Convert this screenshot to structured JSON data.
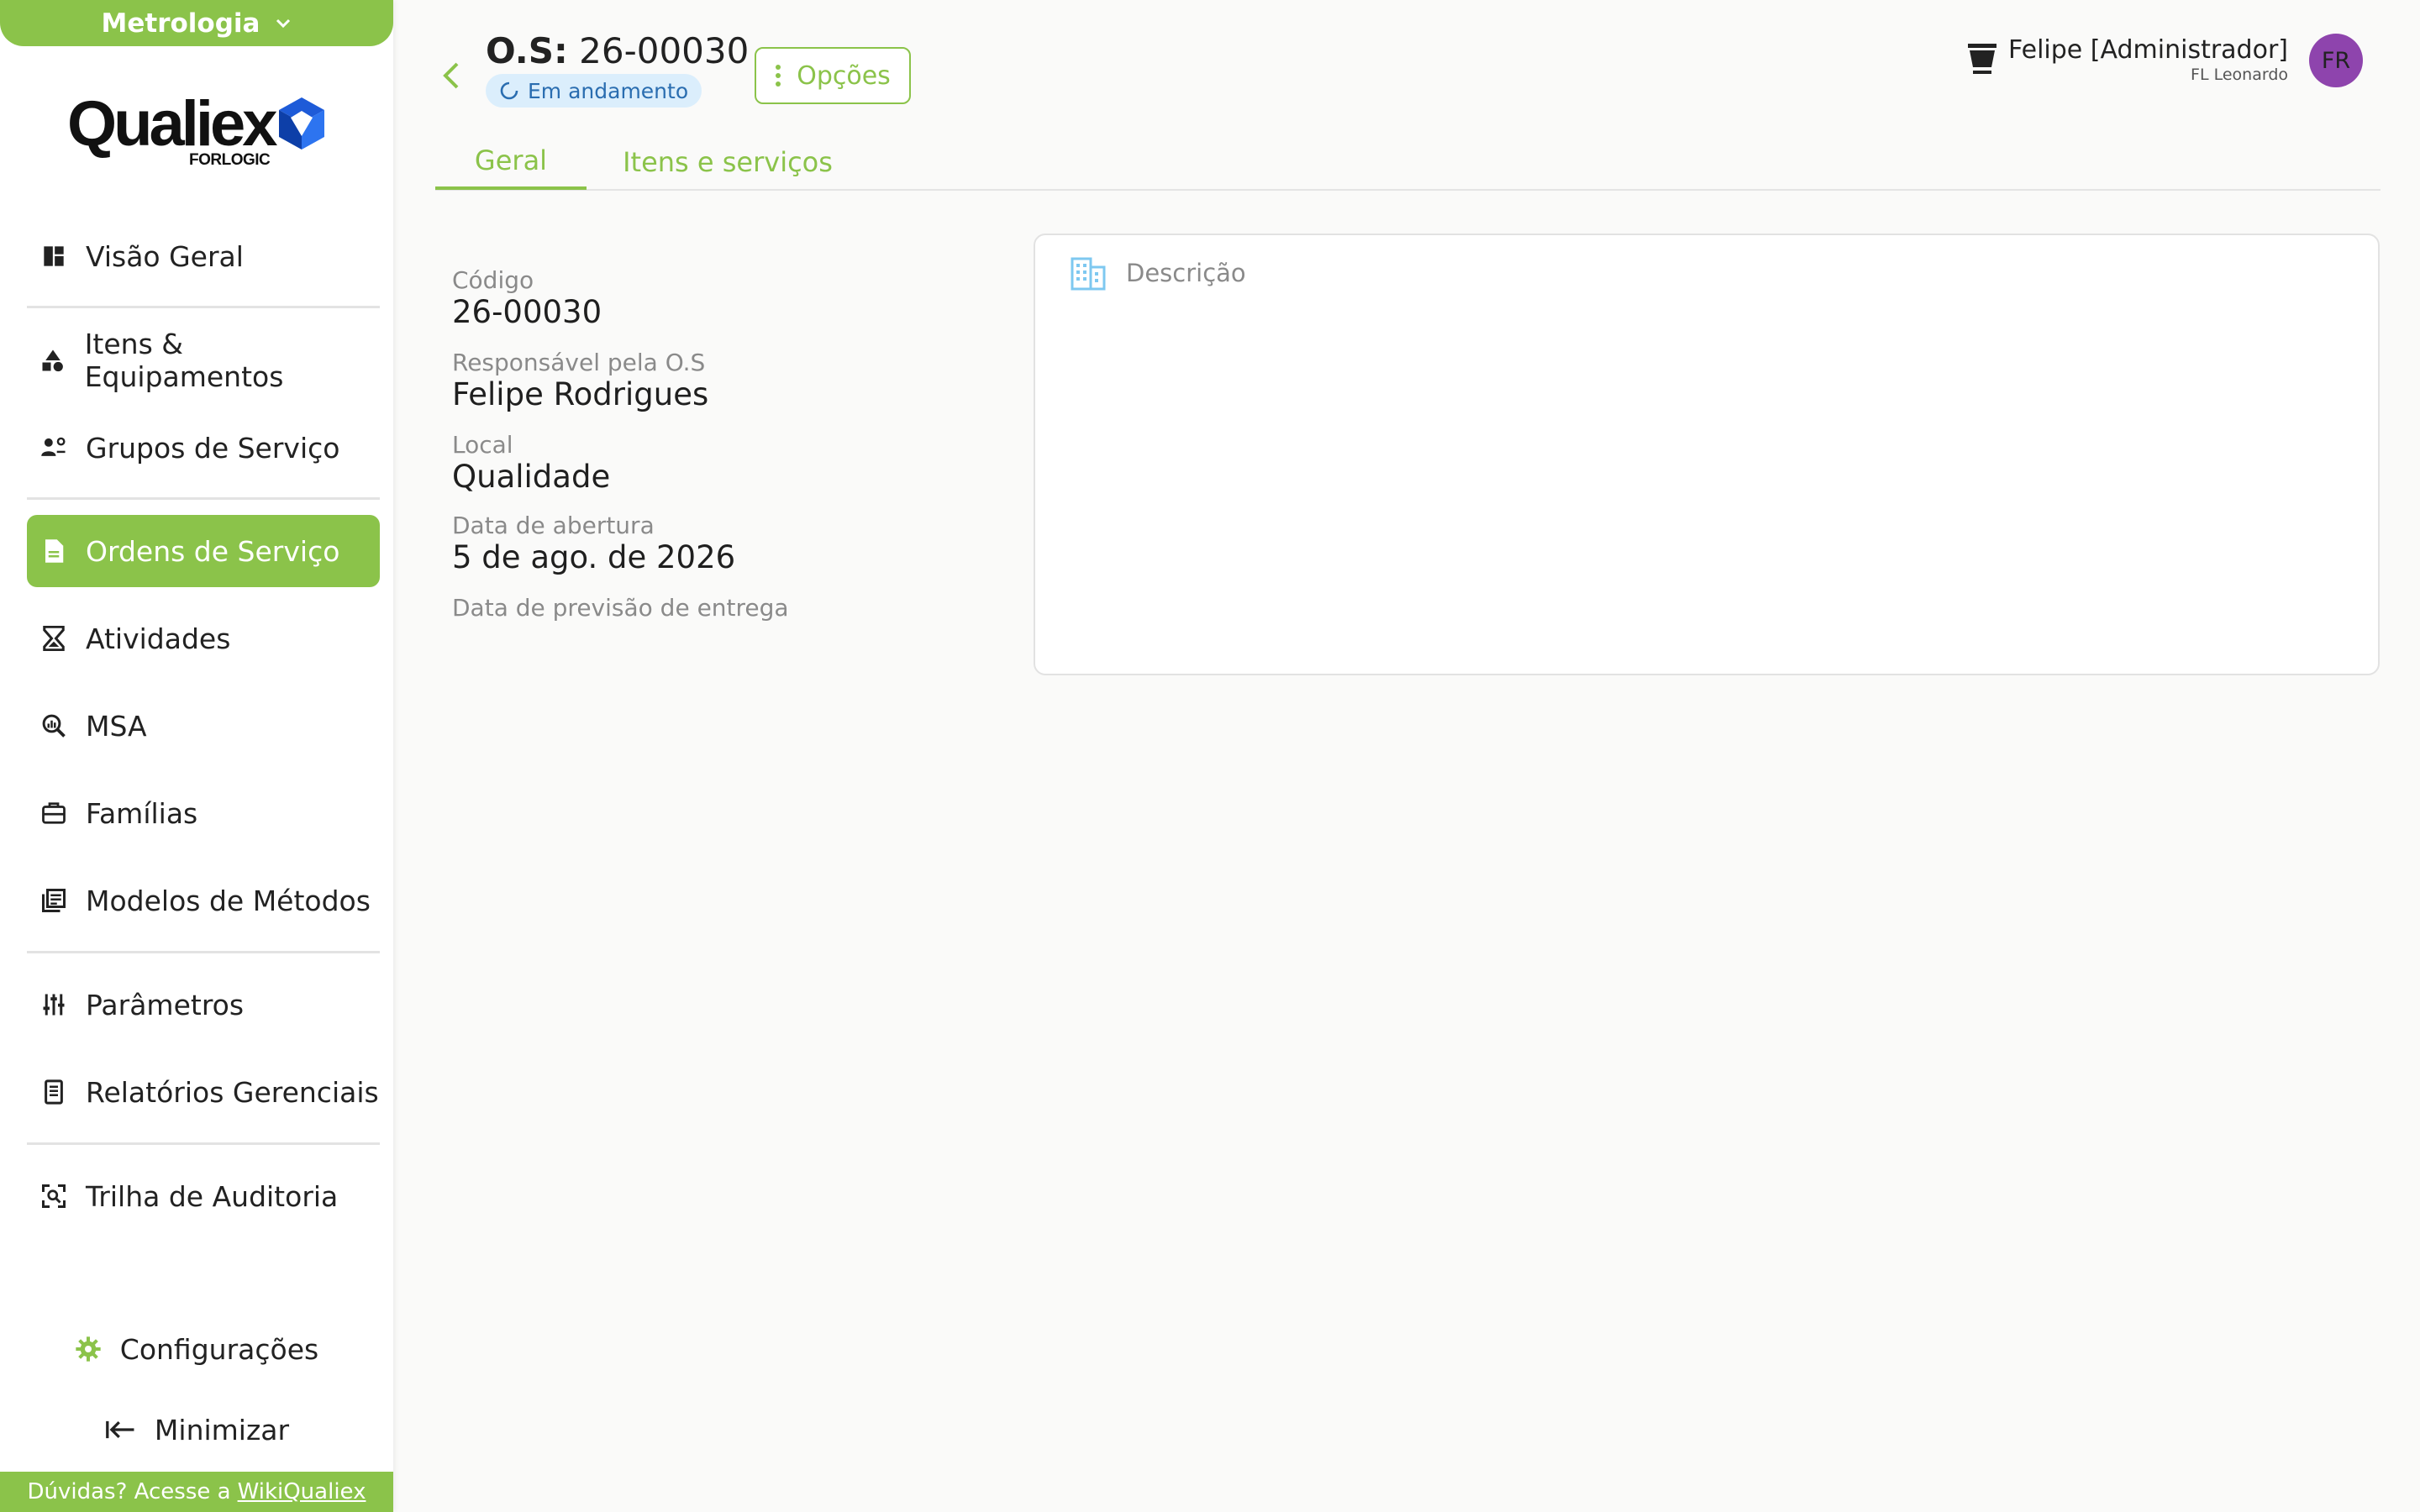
{
  "module_switch": {
    "label": "Metrologia"
  },
  "logo": {
    "word": "Qualiex",
    "sub": "FORLOGIC"
  },
  "sidebar": {
    "items": [
      {
        "label": "Visão Geral",
        "icon": "dashboard-icon"
      },
      {
        "label": "Itens & Equipamentos",
        "icon": "shapes-icon"
      },
      {
        "label": "Grupos de Serviço",
        "icon": "group-settings-icon"
      },
      {
        "label": "Ordens de Serviço",
        "icon": "document-icon",
        "active": true
      },
      {
        "label": "Atividades",
        "icon": "hourglass-icon"
      },
      {
        "label": "MSA",
        "icon": "magnify-chart-icon"
      },
      {
        "label": "Famílias",
        "icon": "toolbox-icon"
      },
      {
        "label": "Modelos de Métodos",
        "icon": "library-icon"
      },
      {
        "label": "Parâmetros",
        "icon": "sliders-icon"
      },
      {
        "label": "Relatórios Gerenciais",
        "icon": "report-icon"
      },
      {
        "label": "Trilha de Auditoria",
        "icon": "audit-scan-icon"
      }
    ],
    "settings_label": "Configurações",
    "minimize_label": "Minimizar"
  },
  "help": {
    "prefix": "Dúvidas? Acesse a",
    "link": "WikiQualiex"
  },
  "header": {
    "title_prefix": "O.S:",
    "title_number": "26-00030",
    "status": "Em andamento",
    "options_label": "Opções"
  },
  "user": {
    "name": "Felipe [Administrador]",
    "org": "FL Leonardo",
    "initials": "FR"
  },
  "tabs": [
    {
      "label": "Geral",
      "active": true
    },
    {
      "label": "Itens e serviços",
      "active": false
    }
  ],
  "fields": {
    "codigo_label": "Código",
    "codigo_value": "26-00030",
    "responsavel_label": "Responsável pela O.S",
    "responsavel_value": "Felipe Rodrigues",
    "local_label": "Local",
    "local_value": "Qualidade",
    "abertura_label": "Data de abertura",
    "abertura_value": "5 de ago. de 2026",
    "previsao_label": "Data de previsão de entrega"
  },
  "description": {
    "label": "Descrição"
  },
  "colors": {
    "accent": "#8bc34a",
    "status_bg": "#dbeefc",
    "status_text": "#2a6db0",
    "avatar": "#8e44ad",
    "description_icon": "#7ec8f0"
  }
}
